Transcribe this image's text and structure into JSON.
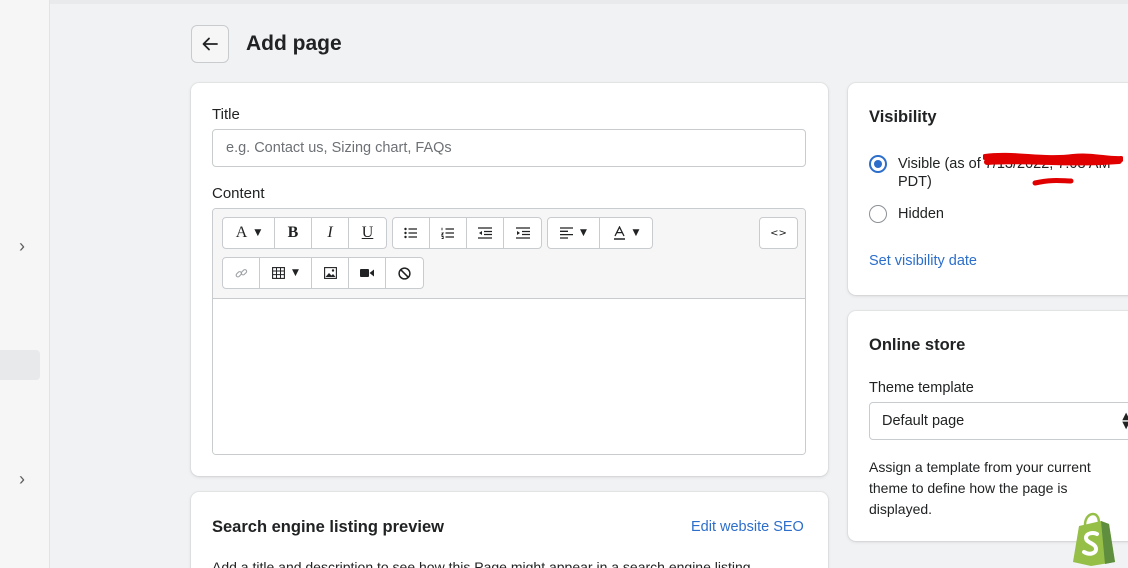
{
  "header": {
    "title": "Add page",
    "back_icon": "arrow-left-icon"
  },
  "main_card": {
    "title_label": "Title",
    "title_placeholder": "e.g. Contact us, Sizing chart, FAQs",
    "content_label": "Content",
    "toolbar": {
      "font": "A",
      "bold": "B",
      "italic": "I",
      "underline": "U",
      "html_toggle": "<>"
    }
  },
  "seo_card": {
    "heading": "Search engine listing preview",
    "edit_link": "Edit website SEO",
    "description": "Add a title and description to see how this Page might appear in a search engine listing"
  },
  "visibility_card": {
    "heading": "Visibility",
    "visible_label": "Visible (as of 7/13/2022, 7:08 AM PDT)",
    "hidden_label": "Hidden",
    "selected": "visible",
    "set_date_link": "Set visibility date"
  },
  "online_store_card": {
    "heading": "Online store",
    "theme_label": "Theme template",
    "theme_value": "Default page",
    "help_text": "Assign a template from your current theme to define how the page is displayed."
  },
  "colors": {
    "accent": "#2c6ecb",
    "background": "#f1f2f3",
    "annotation_red": "#e00000",
    "shopify_green": "#95bf47"
  }
}
